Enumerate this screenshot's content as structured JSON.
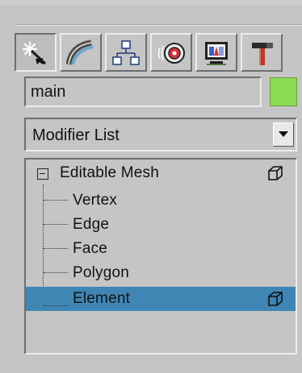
{
  "object_name": "main",
  "object_color": "#8ADC52",
  "modifier_dropdown": {
    "selected": "Modifier List"
  },
  "tabs": [
    {
      "icon": "create-wand-icon"
    },
    {
      "icon": "modify-curve-icon"
    },
    {
      "icon": "hierarchy-icon"
    },
    {
      "icon": "motion-icon"
    },
    {
      "icon": "display-icon"
    },
    {
      "icon": "utilities-hammer-icon"
    }
  ],
  "stack": {
    "root": {
      "label": "Editable Mesh"
    },
    "items": [
      {
        "label": "Vertex"
      },
      {
        "label": "Edge"
      },
      {
        "label": "Face"
      },
      {
        "label": "Polygon"
      },
      {
        "label": "Element",
        "selected": true
      }
    ]
  },
  "colors": {
    "selection": "#3F86B5",
    "panel": "#C5C5C5"
  }
}
